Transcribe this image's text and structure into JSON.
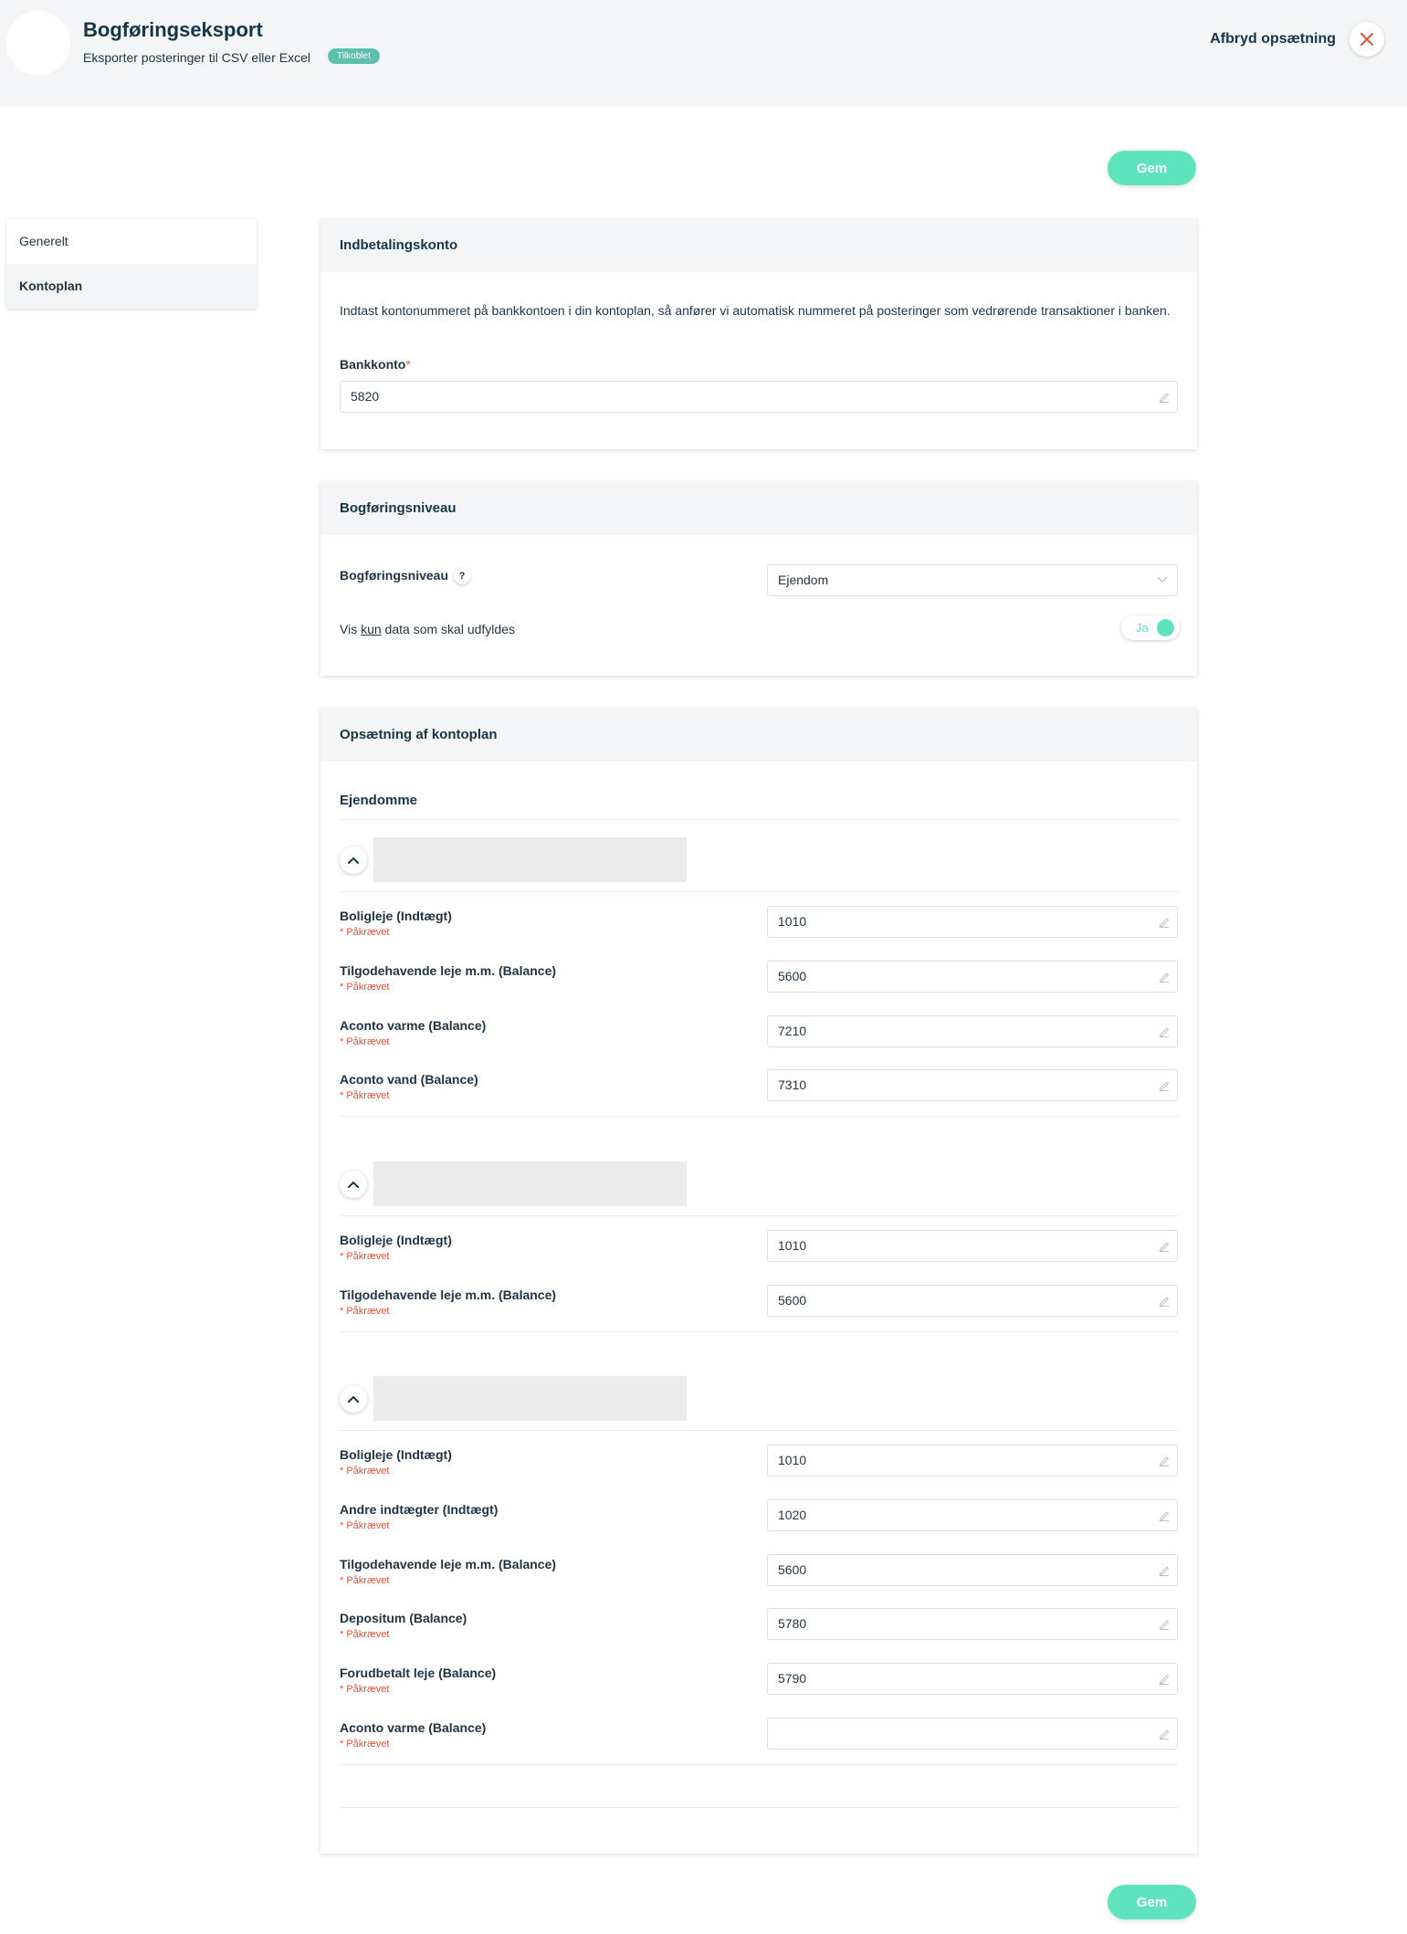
{
  "header": {
    "title": "Bogføringseksport",
    "subtitle": "Eksporter posteringer til CSV eller Excel",
    "badge": "Tilkoblet",
    "cancel_label": "Afbryd opsætning"
  },
  "save_label": "Gem",
  "sidebar": {
    "items": [
      {
        "label": "Generelt",
        "active": false
      },
      {
        "label": "Kontoplan",
        "active": true
      }
    ]
  },
  "payment_card": {
    "title": "Indbetalingskonto",
    "description": "Indtast kontonummeret på bankkontoen i din kontoplan, så anfører vi automatisk nummeret på posteringer som vedrørende transaktioner i banken.",
    "field_label": "Bankkonto",
    "required_star": "*",
    "field_value": "5820"
  },
  "level_card": {
    "title": "Bogføringsniveau",
    "field_label": "Bogføringsniveau",
    "help": "?",
    "select_value": "Ejendom",
    "filter_prefix": "Vis ",
    "filter_underline": "kun",
    "filter_suffix": " data som skal udfyldes",
    "toggle_label": "Ja"
  },
  "chart_card": {
    "title": "Opsætning af kontoplan",
    "section_title": "Ejendomme",
    "required_text": "* Påkrævet",
    "groups": [
      {
        "rows": [
          {
            "label": "Boligleje (Indtægt)",
            "value": "1010"
          },
          {
            "label": "Tilgodehavende leje m.m. (Balance)",
            "value": "5600"
          },
          {
            "label": "Aconto varme (Balance)",
            "value": "7210"
          },
          {
            "label": "Aconto vand (Balance)",
            "value": "7310"
          }
        ]
      },
      {
        "rows": [
          {
            "label": "Boligleje (Indtægt)",
            "value": "1010"
          },
          {
            "label": "Tilgodehavende leje m.m. (Balance)",
            "value": "5600"
          }
        ]
      },
      {
        "rows": [
          {
            "label": "Boligleje (Indtægt)",
            "value": "1010"
          },
          {
            "label": "Andre indtægter (Indtægt)",
            "value": "1020"
          },
          {
            "label": "Tilgodehavende leje m.m. (Balance)",
            "value": "5600"
          },
          {
            "label": "Depositum (Balance)",
            "value": "5780"
          },
          {
            "label": "Forudbetalt leje (Balance)",
            "value": "5790"
          },
          {
            "label": "Aconto varme (Balance)",
            "value": ""
          }
        ]
      }
    ]
  },
  "colors": {
    "accent": "#5fe3bf",
    "badge": "#5bc0ae",
    "required": "#e0533a",
    "text": "#1d3445"
  }
}
